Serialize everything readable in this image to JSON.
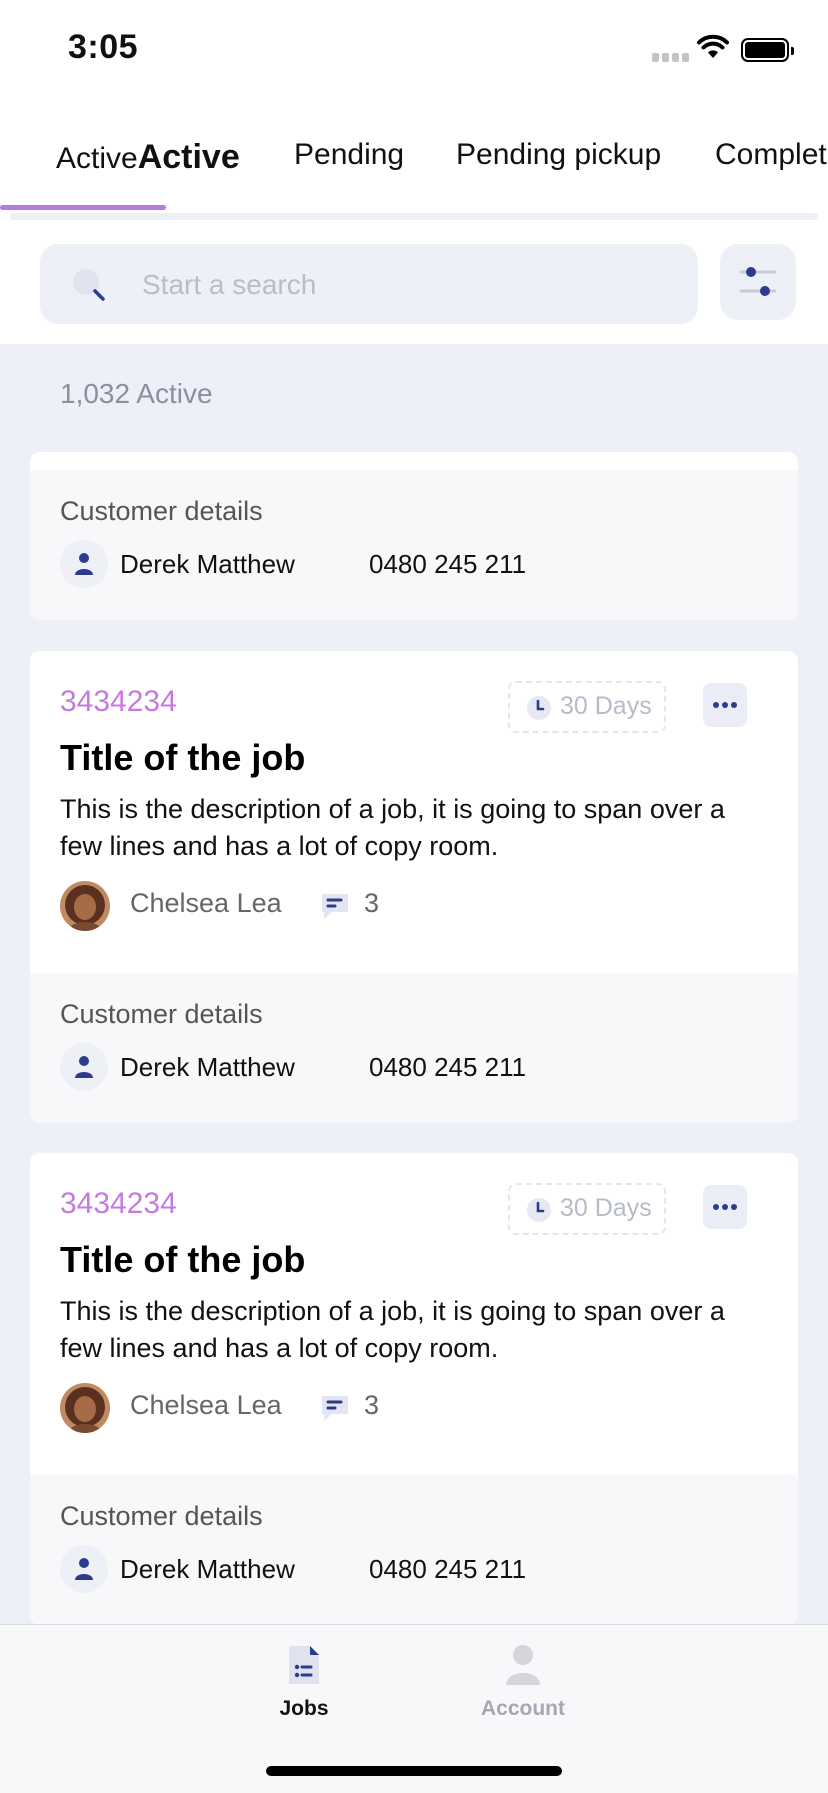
{
  "status_bar": {
    "time": "3:05"
  },
  "tabs": [
    {
      "label_light": "Active",
      "label_bold": "Active",
      "active": true
    },
    {
      "label": "Pending"
    },
    {
      "label": "Pending pickup"
    },
    {
      "label": "Complet"
    }
  ],
  "search": {
    "placeholder": "Start a search",
    "value": ""
  },
  "list": {
    "count_label": "1,032 Active",
    "cards": [
      {
        "customer_label": "Customer details",
        "customer_name": "Derek Matthew",
        "customer_phone": "0480 245 211"
      },
      {
        "job_id": "3434234",
        "days": "30 Days",
        "title": "Title of the job",
        "description": "This is the description of a job, it is going to span over a few lines and has a lot of copy room.",
        "assignee": "Chelsea Lea",
        "comments": "3",
        "customer_label": "Customer details",
        "customer_name": "Derek Matthew",
        "customer_phone": "0480 245 211"
      },
      {
        "job_id": "3434234",
        "days": "30 Days",
        "title": "Title of the job",
        "description": "This is the description of a job, it is going to span over a few lines and has a lot of copy room.",
        "assignee": "Chelsea Lea",
        "comments": "3",
        "customer_label": "Customer details",
        "customer_name": "Derek Matthew",
        "customer_phone": "0480 245 211"
      }
    ]
  },
  "bottom_nav": {
    "items": [
      {
        "label": "Jobs",
        "icon": "document-list-icon",
        "active": true
      },
      {
        "label": "Account",
        "icon": "person-icon",
        "active": false
      }
    ]
  },
  "colors": {
    "accent": "#b57be8",
    "job_id": "#c57ae0",
    "icon_navy": "#2d3b8c",
    "list_background": "#edf0f6"
  }
}
